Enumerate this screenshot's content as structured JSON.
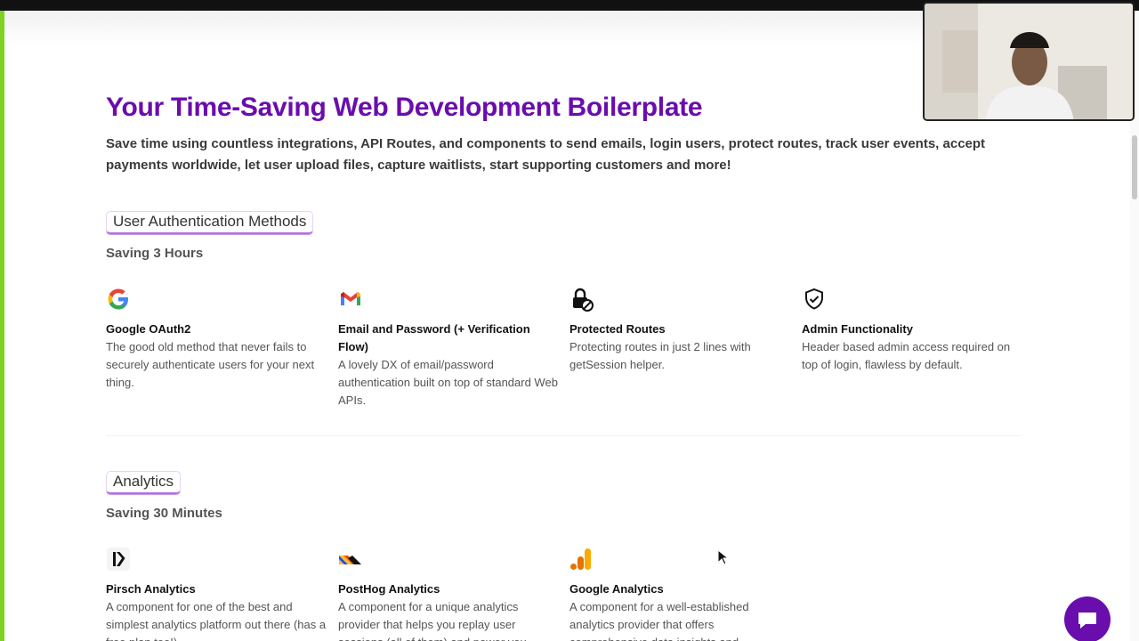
{
  "hero": {
    "title": "Your Time-Saving Web Development Boilerplate",
    "subtitle": "Save time using countless integrations, API Routes, and components to send emails, login users, protect routes, track user events, accept payments worldwide, let user upload files, capture waitlists, start supporting customers and more!"
  },
  "sections": [
    {
      "tag": "User Authentication Methods",
      "saving": "Saving 3 Hours",
      "features": [
        {
          "icon": "google-icon",
          "title": "Google OAuth2",
          "desc": "The good old method that never fails to securely authenticate users for your next thing."
        },
        {
          "icon": "gmail-icon",
          "title": "Email and Password (+ Verification Flow)",
          "desc": "A lovely DX of email/password authentication built on top of standard Web APIs."
        },
        {
          "icon": "lock-icon",
          "title": "Protected Routes",
          "desc": "Protecting routes in just 2 lines with getSession helper."
        },
        {
          "icon": "shield-check-icon",
          "title": "Admin Functionality",
          "desc": "Header based admin access required on top of login, flawless by default."
        }
      ]
    },
    {
      "tag": "Analytics",
      "saving": "Saving 30 Minutes",
      "features": [
        {
          "icon": "pirsch-icon",
          "title": "Pirsch Analytics",
          "desc": "A component for one of the best and simplest analytics platform out there (has a free plan too!)"
        },
        {
          "icon": "posthog-icon",
          "title": "PostHog Analytics",
          "desc": "A component for a unique analytics provider that helps you replay user sessions (all of them) and power you"
        },
        {
          "icon": "google-analytics-icon",
          "title": "Google Analytics",
          "desc": "A component for a well-established analytics provider that offers comprehensive data insights and"
        }
      ]
    }
  ],
  "colors": {
    "accent": "#6a0dad",
    "frame": "#7dd321"
  },
  "overlay": {
    "webcam_icon": "webcam-video-icon",
    "chat_icon": "chat-bubble-icon"
  }
}
